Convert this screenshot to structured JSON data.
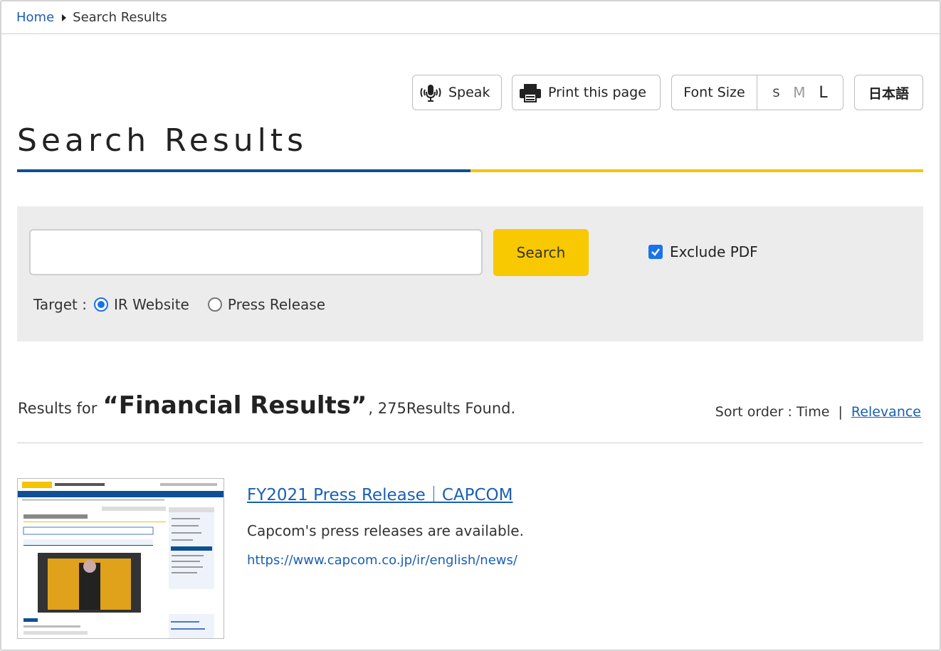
{
  "breadcrumb": {
    "home": "Home",
    "current": "Search Results"
  },
  "toolbar": {
    "speak": "Speak",
    "print": "Print this page",
    "font_size_label": "Font Size",
    "sizes": {
      "s": "S",
      "m": "M",
      "l": "L"
    },
    "language": "日本語"
  },
  "page_title": "Search Results",
  "search": {
    "input_value": "",
    "button": "Search",
    "exclude_pdf": {
      "label": "Exclude PDF",
      "checked": true
    },
    "target_label": "Target :",
    "targets": [
      {
        "label": "IR Website",
        "selected": true
      },
      {
        "label": "Press Release",
        "selected": false
      }
    ]
  },
  "results": {
    "prefix": "Results for",
    "query": "“Financial Results”",
    "suffix": ", 275Results Found.",
    "sort_label": "Sort order : Time",
    "sort_sep": "|",
    "sort_relevance": "Relevance",
    "items": [
      {
        "title": "FY2021 Press Release｜CAPCOM",
        "description": "Capcom's press releases are available.",
        "url": "https://www.capcom.co.jp/ir/english/news/"
      }
    ]
  },
  "colors": {
    "accent_blue": "#0e4f96",
    "accent_yellow": "#f5c400",
    "link": "#1a5fb4"
  }
}
